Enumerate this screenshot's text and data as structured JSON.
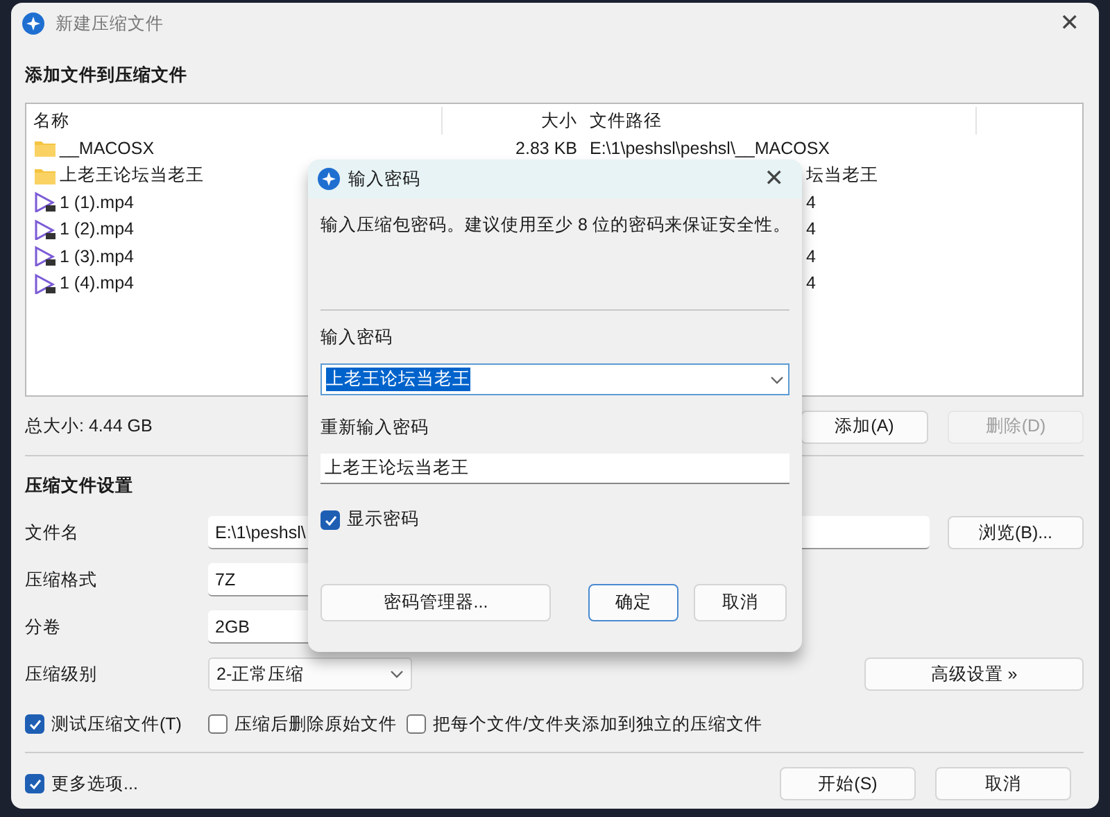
{
  "window": {
    "title": "新建压缩文件",
    "close": "✕"
  },
  "files": {
    "heading": "添加文件到压缩文件",
    "columns": [
      "名称",
      "大小",
      "文件路径"
    ],
    "rows": [
      {
        "kind": "folder",
        "name": "__MACOSX",
        "size": "2.83 KB",
        "path": "E:\\1\\peshsl\\peshsl\\__MACOSX"
      },
      {
        "kind": "folder",
        "name": "上老王论坛当老王",
        "path": "坛当老王",
        "cut": true
      },
      {
        "kind": "video",
        "name": "1 (1).mp4",
        "path": "4",
        "cut": true
      },
      {
        "kind": "video",
        "name": "1 (2).mp4",
        "path": "4",
        "cut": true
      },
      {
        "kind": "video",
        "name": "1 (3).mp4",
        "path": "4",
        "cut": true
      },
      {
        "kind": "video",
        "name": "1 (4).mp4",
        "path": "4",
        "cut": true
      }
    ]
  },
  "total": "总大小: 4.44 GB",
  "list_buttons": [
    {
      "label": "添加(A)",
      "disabled": false
    },
    {
      "label": "删除(D)",
      "disabled": true
    }
  ],
  "settings": {
    "heading": "压缩文件设置",
    "fields": [
      {
        "kind": "text",
        "label": "文件名",
        "value": "E:\\1\\peshsl\\",
        "button": "浏览(B)..."
      },
      {
        "kind": "text",
        "label": "压缩格式",
        "value": "7Z"
      },
      {
        "kind": "text",
        "label": "分卷",
        "value": "2GB"
      },
      {
        "kind": "select",
        "label": "压缩级别",
        "value": "2-正常压缩",
        "button": "高级设置 »"
      }
    ],
    "options": [
      {
        "label": "测试压缩文件(T)",
        "checked": true
      },
      {
        "label": "压缩后删除原始文件",
        "checked": false
      },
      {
        "label": "把每个文件/文件夹添加到独立的压缩文件",
        "checked": false
      }
    ]
  },
  "more_options": {
    "label": "更多选项...",
    "checked": true
  },
  "buttons": [
    {
      "label": "开始(S)"
    },
    {
      "label": "取消"
    }
  ],
  "dialog": {
    "title": "输入密码",
    "close": "✕",
    "description": "输入压缩包密码。建议使用至少 8 位的密码来保证安全性。",
    "password_label": "输入密码",
    "password": "上老王论坛当老王",
    "repeat_label": "重新输入密码",
    "repeat": "上老王论坛当老王",
    "show_password": {
      "label": "显示密码",
      "checked": true
    },
    "buttons": [
      {
        "label": "密码管理器...",
        "default": false
      },
      {
        "label": "确定",
        "default": true
      },
      {
        "label": "取消",
        "default": false
      }
    ]
  }
}
